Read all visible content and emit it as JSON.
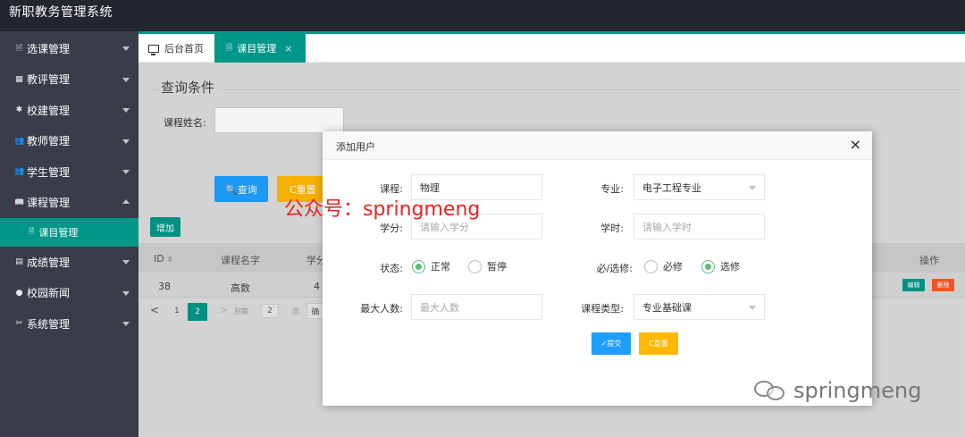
{
  "app": {
    "title": "新职教务管理系统"
  },
  "sidebar": {
    "items": [
      {
        "icon": "file-icon",
        "label": "选课管理",
        "expanded": false
      },
      {
        "icon": "grid-icon",
        "label": "教评管理",
        "expanded": false
      },
      {
        "icon": "gear-icon",
        "label": "校建管理",
        "expanded": false
      },
      {
        "icon": "users-icon",
        "label": "教师管理",
        "expanded": false
      },
      {
        "icon": "users-icon",
        "label": "学生管理",
        "expanded": false
      },
      {
        "icon": "book-icon",
        "label": "课程管理",
        "expanded": true
      },
      {
        "icon": "chart-icon",
        "label": "成绩管理",
        "expanded": false
      },
      {
        "icon": "chat-icon",
        "label": "校园新闻",
        "expanded": false
      },
      {
        "icon": "tools-icon",
        "label": "系统管理",
        "expanded": false
      }
    ],
    "sub_item": {
      "label": "课目管理"
    }
  },
  "tabs": [
    {
      "label": "后台首页",
      "active": false
    },
    {
      "label": "课目管理",
      "active": true,
      "close": "×"
    }
  ],
  "query": {
    "title": "查询条件",
    "course_name_label": "课程姓名:",
    "search_button": "🔍查询",
    "reset_button": "C重置"
  },
  "toolbar": {
    "add_button": "增加"
  },
  "table": {
    "columns": [
      "ID",
      "课程名字",
      "学分",
      "操作"
    ],
    "sort_icon": "⇕",
    "rows": [
      {
        "id": "38",
        "name": "高数",
        "credit": "4",
        "edit": "编辑",
        "delete": "删除"
      }
    ]
  },
  "pager": {
    "prev": "<",
    "page_1": "1",
    "current": "2",
    "next": ">",
    "goto_label": "到第",
    "page_input": "2",
    "page_unit": "页",
    "ok": "确"
  },
  "modal": {
    "title": "添加用户",
    "close": "×",
    "fields": {
      "course_label": "课程:",
      "course_value": "物理",
      "major_label": "专业:",
      "major_value": "电子工程专业",
      "credit_label": "学分:",
      "credit_placeholder": "请输入学分",
      "hours_label": "学时:",
      "hours_placeholder": "请输入学时",
      "status_label": "状态:",
      "status_normal": "正常",
      "status_paused": "暂停",
      "elective_label": "必/选修:",
      "required_option": "必修",
      "elective_option": "选修",
      "max_label": "最大人数:",
      "max_placeholder": "最大人数",
      "type_label": "课程类型:",
      "type_value": "专业基础课"
    },
    "selected": {
      "status": "正常",
      "elective": "选修"
    },
    "submit_button": "✓提交",
    "reset_button": "C重置"
  },
  "watermarks": {
    "red": "公众号：springmeng",
    "gray": "springmeng"
  },
  "colors": {
    "topbar": "#23262e",
    "sidebar": "#393d49",
    "accent": "#009688",
    "primary": "#1e9fff",
    "warn": "#ffb800",
    "danger": "#ff5722",
    "radio_on": "#5fb878",
    "watermark_red": "#e8231e"
  }
}
